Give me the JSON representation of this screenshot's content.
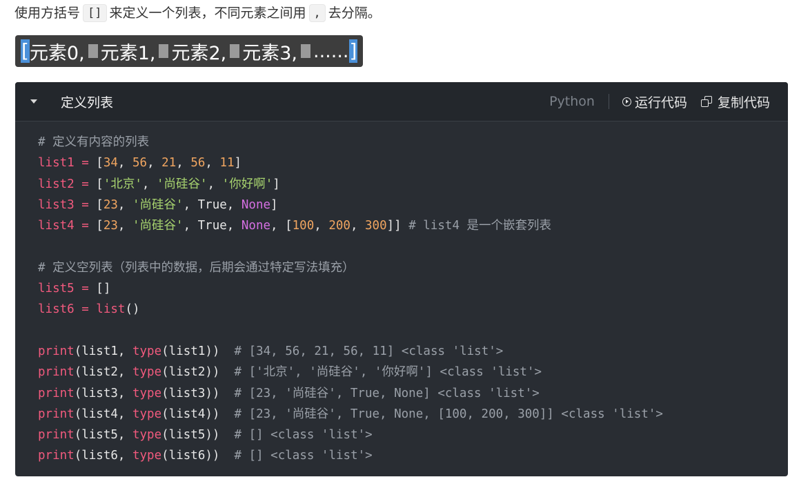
{
  "intro": {
    "text_before": "使用方括号",
    "code_brackets": "[]",
    "text_middle": "来定义一个列表，不同元素之间用",
    "code_comma": ",",
    "text_after": "去分隔。"
  },
  "syntax": {
    "open": "[",
    "items": [
      "元素0,",
      "元素1,",
      "元素2,",
      "元素3,",
      "......"
    ],
    "close": "]"
  },
  "code_block": {
    "title": "定义列表",
    "language": "Python",
    "run_label": "运行代码",
    "copy_label": "复制代码",
    "lines": [
      [
        {
          "t": "c",
          "v": "# 定义有内容的列表"
        }
      ],
      [
        {
          "t": "v",
          "v": "list1"
        },
        {
          "t": "o",
          "v": " = "
        },
        {
          "t": "p",
          "v": "["
        },
        {
          "t": "n",
          "v": "34"
        },
        {
          "t": "p",
          "v": ", "
        },
        {
          "t": "n",
          "v": "56"
        },
        {
          "t": "p",
          "v": ", "
        },
        {
          "t": "n",
          "v": "21"
        },
        {
          "t": "p",
          "v": ", "
        },
        {
          "t": "n",
          "v": "56"
        },
        {
          "t": "p",
          "v": ", "
        },
        {
          "t": "n",
          "v": "11"
        },
        {
          "t": "p",
          "v": "]"
        }
      ],
      [
        {
          "t": "v",
          "v": "list2"
        },
        {
          "t": "o",
          "v": " = "
        },
        {
          "t": "p",
          "v": "["
        },
        {
          "t": "s",
          "v": "'北京'"
        },
        {
          "t": "p",
          "v": ", "
        },
        {
          "t": "s",
          "v": "'尚硅谷'"
        },
        {
          "t": "p",
          "v": ", "
        },
        {
          "t": "s",
          "v": "'你好啊'"
        },
        {
          "t": "p",
          "v": "]"
        }
      ],
      [
        {
          "t": "v",
          "v": "list3"
        },
        {
          "t": "o",
          "v": " = "
        },
        {
          "t": "p",
          "v": "["
        },
        {
          "t": "n",
          "v": "23"
        },
        {
          "t": "p",
          "v": ", "
        },
        {
          "t": "s",
          "v": "'尚硅谷'"
        },
        {
          "t": "p",
          "v": ", True, "
        },
        {
          "t": "k",
          "v": "None"
        },
        {
          "t": "p",
          "v": "]"
        }
      ],
      [
        {
          "t": "v",
          "v": "list4"
        },
        {
          "t": "o",
          "v": " = "
        },
        {
          "t": "p",
          "v": "["
        },
        {
          "t": "n",
          "v": "23"
        },
        {
          "t": "p",
          "v": ", "
        },
        {
          "t": "s",
          "v": "'尚硅谷'"
        },
        {
          "t": "p",
          "v": ", True, "
        },
        {
          "t": "k",
          "v": "None"
        },
        {
          "t": "p",
          "v": ", ["
        },
        {
          "t": "n",
          "v": "100"
        },
        {
          "t": "p",
          "v": ", "
        },
        {
          "t": "n",
          "v": "200"
        },
        {
          "t": "p",
          "v": ", "
        },
        {
          "t": "n",
          "v": "300"
        },
        {
          "t": "p",
          "v": "]] "
        },
        {
          "t": "c",
          "v": "# list4 是一个嵌套列表"
        }
      ],
      [],
      [
        {
          "t": "c",
          "v": "# 定义空列表（列表中的数据，后期会通过特定写法填充）"
        }
      ],
      [
        {
          "t": "v",
          "v": "list5"
        },
        {
          "t": "o",
          "v": " = "
        },
        {
          "t": "p",
          "v": "[]"
        }
      ],
      [
        {
          "t": "v",
          "v": "list6"
        },
        {
          "t": "o",
          "v": " = "
        },
        {
          "t": "f",
          "v": "list"
        },
        {
          "t": "p",
          "v": "()"
        }
      ],
      [],
      [
        {
          "t": "f",
          "v": "print"
        },
        {
          "t": "p",
          "v": "(list1, "
        },
        {
          "t": "f",
          "v": "type"
        },
        {
          "t": "p",
          "v": "(list1))  "
        },
        {
          "t": "c",
          "v": "# [34, 56, 21, 56, 11] <class 'list'>"
        }
      ],
      [
        {
          "t": "f",
          "v": "print"
        },
        {
          "t": "p",
          "v": "(list2, "
        },
        {
          "t": "f",
          "v": "type"
        },
        {
          "t": "p",
          "v": "(list2))  "
        },
        {
          "t": "c",
          "v": "# ['北京', '尚硅谷', '你好啊'] <class 'list'>"
        }
      ],
      [
        {
          "t": "f",
          "v": "print"
        },
        {
          "t": "p",
          "v": "(list3, "
        },
        {
          "t": "f",
          "v": "type"
        },
        {
          "t": "p",
          "v": "(list3))  "
        },
        {
          "t": "c",
          "v": "# [23, '尚硅谷', True, None] <class 'list'>"
        }
      ],
      [
        {
          "t": "f",
          "v": "print"
        },
        {
          "t": "p",
          "v": "(list4, "
        },
        {
          "t": "f",
          "v": "type"
        },
        {
          "t": "p",
          "v": "(list4))  "
        },
        {
          "t": "c",
          "v": "# [23, '尚硅谷', True, None, [100, 200, 300]] <class 'list'>"
        }
      ],
      [
        {
          "t": "f",
          "v": "print"
        },
        {
          "t": "p",
          "v": "(list5, "
        },
        {
          "t": "f",
          "v": "type"
        },
        {
          "t": "p",
          "v": "(list5))  "
        },
        {
          "t": "c",
          "v": "# [] <class 'list'>"
        }
      ],
      [
        {
          "t": "f",
          "v": "print"
        },
        {
          "t": "p",
          "v": "(list6, "
        },
        {
          "t": "f",
          "v": "type"
        },
        {
          "t": "p",
          "v": "(list6))  "
        },
        {
          "t": "c",
          "v": "# [] <class 'list'>"
        }
      ]
    ]
  },
  "colors": {
    "panel_bg": "#292d33",
    "header_bg": "#23272c",
    "variable": "#f25a7e",
    "number": "#f0a560",
    "string": "#a8d46f",
    "keyword": "#d570e3",
    "comment": "#9aa0a8",
    "bracket_highlight": "#4a90d9"
  }
}
